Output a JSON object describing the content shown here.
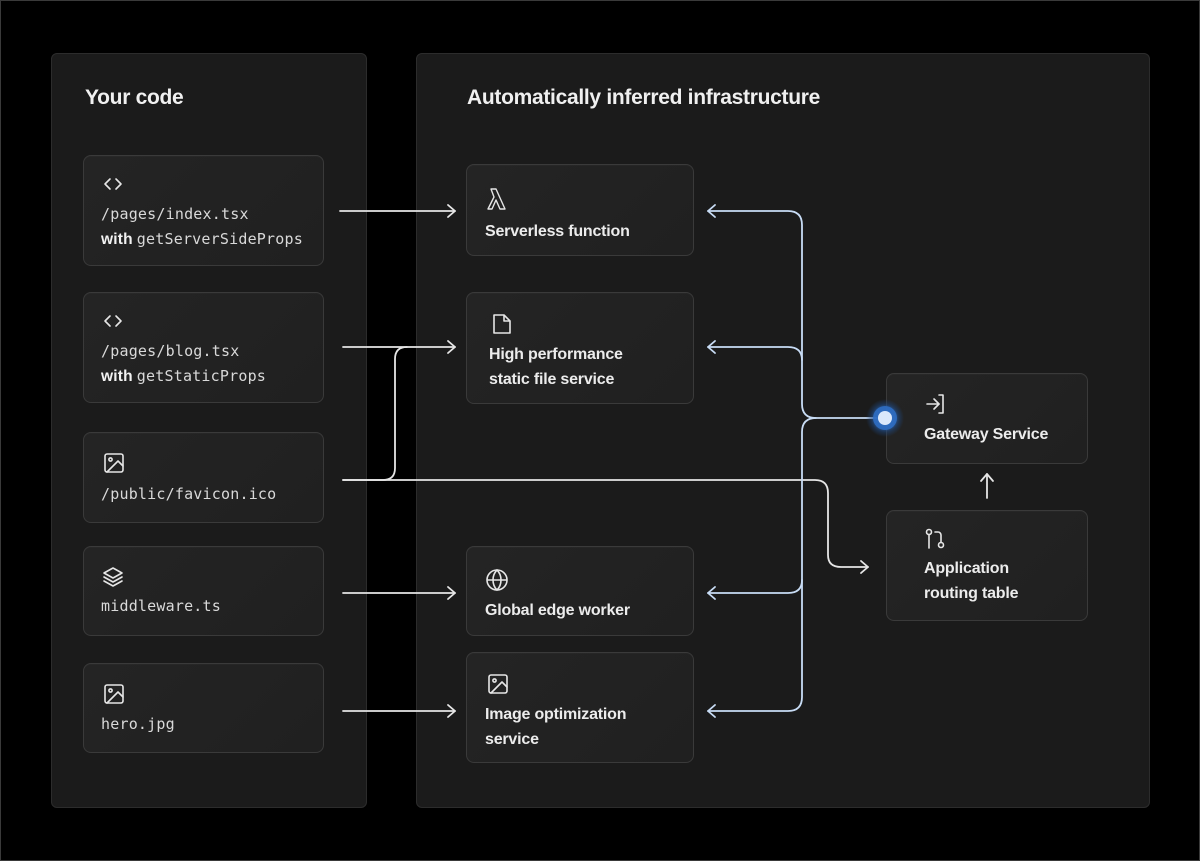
{
  "diagram": {
    "left_panel": {
      "title": "Your code",
      "items": [
        {
          "icon": "code-brackets-icon",
          "path": "/pages/index.tsx",
          "with_label": "with",
          "method": "getServerSideProps"
        },
        {
          "icon": "code-brackets-icon",
          "path": "/pages/blog.tsx",
          "with_label": "with",
          "method": "getStaticProps"
        },
        {
          "icon": "image-icon",
          "path": "/public/favicon.ico"
        },
        {
          "icon": "layers-icon",
          "path": "middleware.ts"
        },
        {
          "icon": "image-icon",
          "path": "hero.jpg"
        }
      ]
    },
    "right_panel": {
      "title": "Automatically inferred infrastructure",
      "services": [
        {
          "icon": "lambda-icon",
          "line1": "Serverless function",
          "line2": ""
        },
        {
          "icon": "file-icon",
          "line1": "High performance",
          "line2": "static file service"
        },
        {
          "icon": "globe-icon",
          "line1": "Global edge worker",
          "line2": ""
        },
        {
          "icon": "image-icon",
          "line1": "Image optimization",
          "line2": "service"
        }
      ],
      "gateway": {
        "icon": "sign-in-icon",
        "label": "Gateway Service"
      },
      "routing": {
        "icon": "git-pull-request-icon",
        "line1": "Application",
        "line2": "routing table"
      }
    },
    "edges": [
      {
        "from": "/pages/index.tsx",
        "to": "Serverless function"
      },
      {
        "from": "/pages/blog.tsx",
        "to": "High performance static file service"
      },
      {
        "from": "/public/favicon.ico",
        "to": "High performance static file service"
      },
      {
        "from": "/public/favicon.ico",
        "to": "Application routing table"
      },
      {
        "from": "middleware.ts",
        "to": "Global edge worker"
      },
      {
        "from": "hero.jpg",
        "to": "Image optimization service"
      },
      {
        "from": "Application routing table",
        "to": "Gateway Service"
      },
      {
        "from": "Gateway Service",
        "to": "Serverless function"
      },
      {
        "from": "Gateway Service",
        "to": "High performance static file service"
      },
      {
        "from": "Gateway Service",
        "to": "Global edge worker"
      },
      {
        "from": "Gateway Service",
        "to": "Image optimization service"
      }
    ],
    "colors": {
      "background": "#000000",
      "panel": "#1b1b1b",
      "card": "#222222",
      "code_wire": "#e6e6e6",
      "gateway_wire": "#c8dcf5",
      "gateway_dot": "#dbe8fb",
      "gateway_glow": "#2f6fc4"
    }
  }
}
